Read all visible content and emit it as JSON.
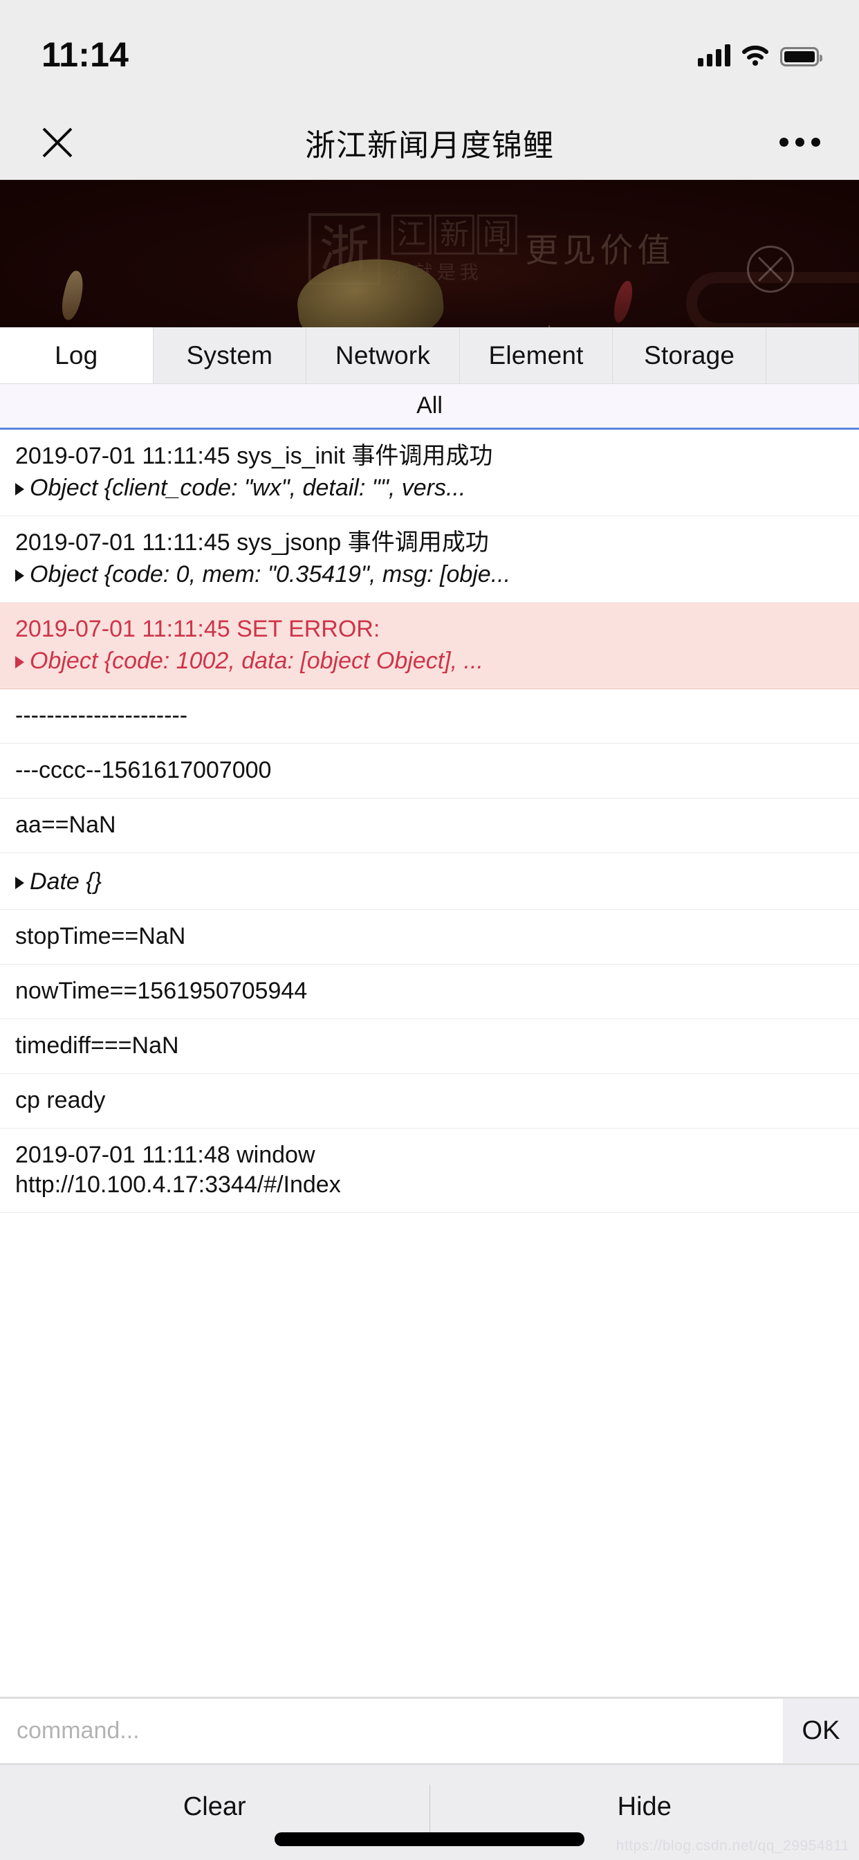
{
  "status_bar": {
    "time": "11:14",
    "signal_icon": "signal-bars-icon",
    "wifi_icon": "wifi-icon",
    "battery_icon": "battery-icon"
  },
  "nav_bar": {
    "close_icon": "close-icon",
    "title": "浙江新闻月度锦鲤",
    "more_icon": "more-dots-icon"
  },
  "banner": {
    "logo_mark": "浙",
    "logo_chars": [
      "江",
      "新",
      "闻"
    ],
    "logo_sub": "浙就是我",
    "slogan": "· 更见价值",
    "close_icon": "banner-close-icon"
  },
  "devtools": {
    "tabs": [
      {
        "label": "Log",
        "active": true
      },
      {
        "label": "System",
        "active": false
      },
      {
        "label": "Network",
        "active": false
      },
      {
        "label": "Element",
        "active": false
      },
      {
        "label": "Storage",
        "active": false
      }
    ],
    "filter": {
      "label": "All",
      "accent": "#5b85dd"
    },
    "logs": [
      {
        "type": "log",
        "main": "2019-07-01 11:11:45 sys_is_init 事件调用成功",
        "object": "Object {client_code: \"wx\", detail: \"\", vers...",
        "expandable": true
      },
      {
        "type": "log",
        "main": "2019-07-01 11:11:45 sys_jsonp 事件调用成功",
        "object": "Object {code: 0, mem: \"0.35419\", msg: [obje...",
        "expandable": true
      },
      {
        "type": "error",
        "main": "2019-07-01 11:11:45 SET ERROR:",
        "object": "Object {code: 1002, data: [object Object], ...",
        "expandable": true
      },
      {
        "type": "log",
        "main": "----------------------",
        "object": "",
        "expandable": false
      },
      {
        "type": "log",
        "main": "---cccc--1561617007000",
        "object": "",
        "expandable": false
      },
      {
        "type": "log",
        "main": "aa==NaN",
        "object": "",
        "expandable": false
      },
      {
        "type": "log",
        "main": "",
        "object": "Date {}",
        "expandable": true
      },
      {
        "type": "log",
        "main": "stopTime==NaN",
        "object": "",
        "expandable": false
      },
      {
        "type": "log",
        "main": "nowTime==1561950705944",
        "object": "",
        "expandable": false
      },
      {
        "type": "log",
        "main": "timediff===NaN",
        "object": "",
        "expandable": false
      },
      {
        "type": "log",
        "main": "cp ready",
        "object": "",
        "expandable": false
      },
      {
        "type": "log",
        "main": "2019-07-01 11:11:48 window\nhttp://10.100.4.17:3344/#/Index",
        "object": "",
        "expandable": false
      }
    ],
    "command": {
      "value": "",
      "placeholder": "command...",
      "ok_label": "OK"
    },
    "actions": {
      "clear_label": "Clear",
      "hide_label": "Hide"
    }
  },
  "watermark": "https://blog.csdn.net/qq_29954811",
  "colors": {
    "error_text": "#cf3449",
    "error_bg": "#fae1dd",
    "accent_blue": "#5b85dd",
    "chrome_gray": "#ededf0"
  }
}
